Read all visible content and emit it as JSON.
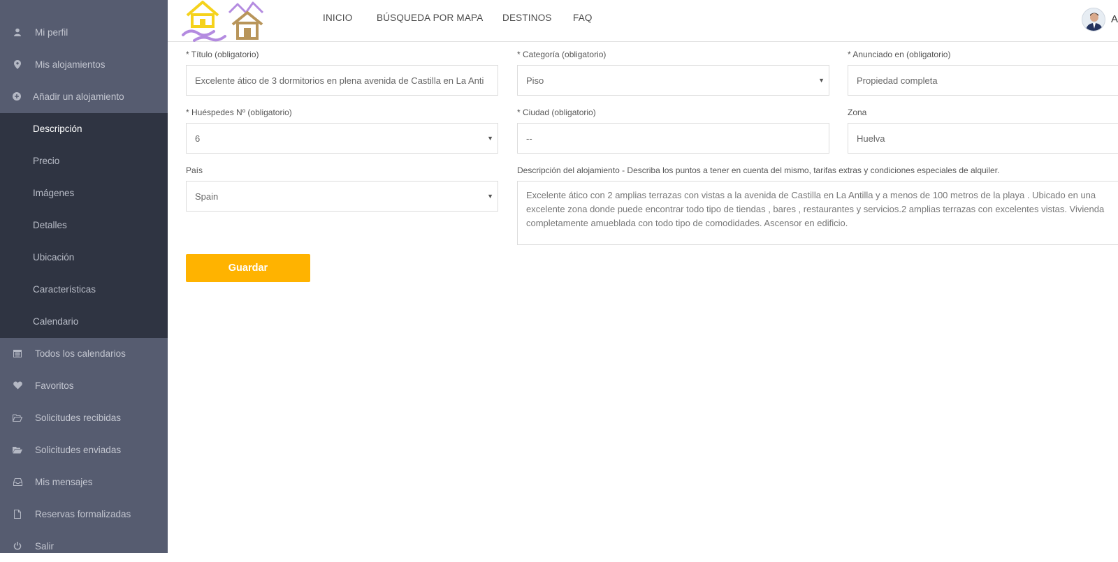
{
  "sidebar": {
    "top_items": [
      {
        "label": "Mi perfil",
        "icon": "user-icon"
      },
      {
        "label": "Mis alojamientos",
        "icon": "map-marker-icon"
      },
      {
        "label": "Añadir un alojamiento",
        "icon": "plus-circle-icon"
      }
    ],
    "sub_items": [
      {
        "label": "Descripción",
        "active": true
      },
      {
        "label": "Precio"
      },
      {
        "label": "Imágenes"
      },
      {
        "label": "Detalles"
      },
      {
        "label": "Ubicación"
      },
      {
        "label": "Características"
      },
      {
        "label": "Calendario"
      }
    ],
    "bottom_items": [
      {
        "label": "Todos los calendarios",
        "icon": "calendar-icon"
      },
      {
        "label": "Favoritos",
        "icon": "heart-icon"
      },
      {
        "label": "Solicitudes recibidas",
        "icon": "folder-open-icon"
      },
      {
        "label": "Solicitudes enviadas",
        "icon": "folder-icon"
      },
      {
        "label": "Mis mensajes",
        "icon": "inbox-icon"
      },
      {
        "label": "Reservas formalizadas",
        "icon": "file-icon"
      },
      {
        "label": "Salir",
        "icon": "power-icon"
      }
    ]
  },
  "header": {
    "nav": [
      "INICIO",
      "BÚSQUEDA POR MAPA",
      "DESTINOS",
      "FAQ"
    ],
    "user_initial": "A"
  },
  "form": {
    "titulo": {
      "label": "* Título (obligatorio)",
      "value": "Excelente ático de 3 dormitorios en plena avenida de Castilla en La Anti"
    },
    "categoria": {
      "label": "* Categoría (obligatorio)",
      "value": "Piso"
    },
    "anunciado": {
      "label": "* Anunciado en (obligatorio)",
      "value": "Propiedad completa"
    },
    "huespedes": {
      "label": "* Huéspedes Nº (obligatorio)",
      "value": "6"
    },
    "ciudad": {
      "label": "* Ciudad (obligatorio)",
      "value": "--"
    },
    "zona": {
      "label": "Zona",
      "value": "Huelva"
    },
    "pais": {
      "label": "País",
      "value": "Spain"
    },
    "descripcion": {
      "label": "Descripción del alojamiento - Describa los puntos a tener en cuenta del mismo, tarifas extras y condiciones especiales de alquiler.",
      "value": "Excelente ático con 2 amplias terrazas con vistas a la avenida de Castilla en La Antilla y a menos de 100 metros de la playa . Ubicado en una excelente zona donde puede encontrar todo tipo de tiendas , bares , restaurantes y servicios.2 amplias terrazas con excelentes vistas. Vivienda completamente amueblada con todo tipo de comodidades. Ascensor en edificio."
    },
    "save_label": "Guardar"
  },
  "colors": {
    "sidebar": "#565c70",
    "submenu": "#2f3442",
    "accent": "#ffb300",
    "logo_yellow": "#f5d21c",
    "logo_purple": "#b48be0",
    "logo_brown": "#b8955a"
  }
}
